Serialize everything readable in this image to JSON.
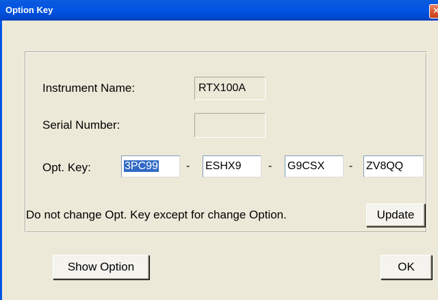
{
  "window": {
    "title": "Option Key",
    "close_glyph": "✕"
  },
  "form": {
    "instrument_name_label": "Instrument Name:",
    "instrument_name_value": "RTX100A",
    "serial_number_label": "Serial Number:",
    "serial_number_value": "",
    "opt_key_label": "Opt. Key:",
    "opt_key_parts": [
      "3PC99",
      "ESHX9",
      "G9CSX",
      "ZV8QQ"
    ],
    "separator": "-",
    "notice": "Do not change Opt. Key except for change Option.",
    "update_label": "Update"
  },
  "footer": {
    "show_option_label": "Show Option",
    "ok_label": "OK"
  },
  "colors": {
    "titlebar": "#0055E5",
    "dialog_bg": "#ECE9D8",
    "selection": "#316AC5",
    "close_button": "#D9572F"
  }
}
